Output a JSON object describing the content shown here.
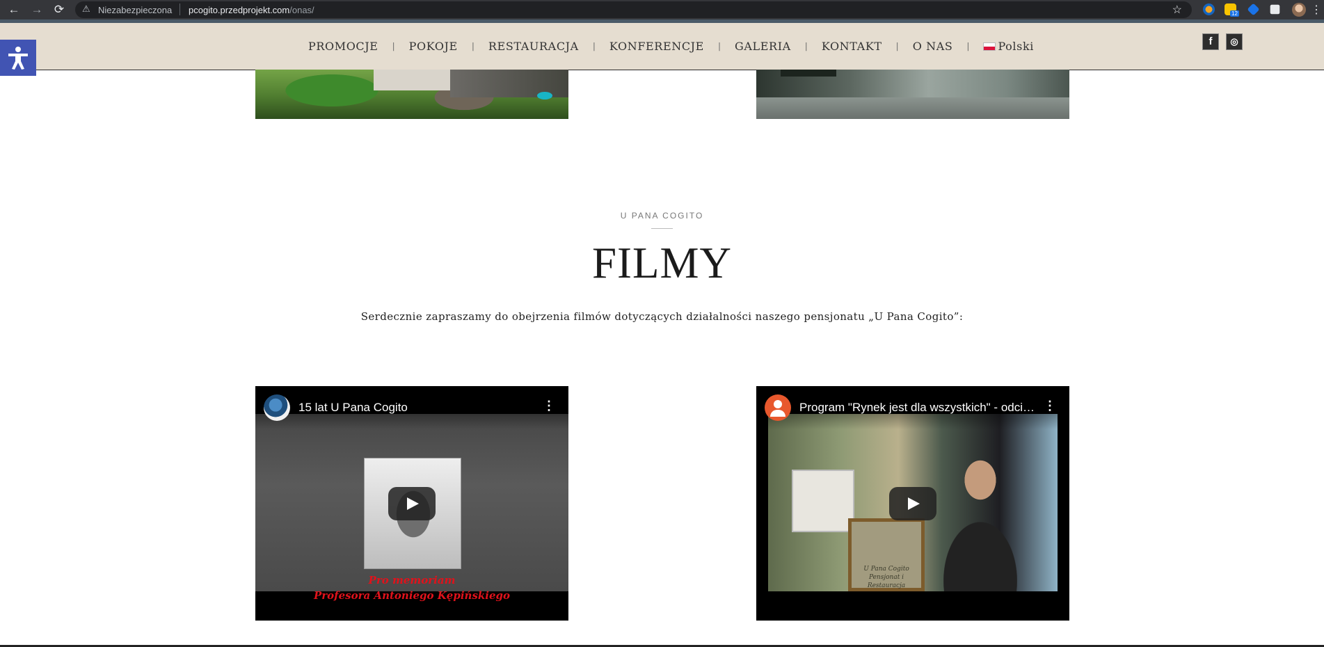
{
  "browser": {
    "security_label": "Niezabezpieczona",
    "url_domain": "pcogito.przedprojekt.com",
    "url_path": "/onas/",
    "extension_badge": "12",
    "back_icon": "←",
    "forward_icon": "→",
    "reload_icon": "⟳",
    "warning_icon": "⚠",
    "star_icon": "☆",
    "menu_icon": "⋮"
  },
  "nav": {
    "items": [
      {
        "label": "PROMOCJE"
      },
      {
        "label": "POKOJE"
      },
      {
        "label": "RESTAURACJA"
      },
      {
        "label": "KONFERENCJE"
      },
      {
        "label": "GALERIA"
      },
      {
        "label": "KONTAKT"
      },
      {
        "label": "O NAS"
      }
    ],
    "separator": "|",
    "language": "Polski",
    "facebook_glyph": "f",
    "tripadvisor_glyph": "◎"
  },
  "section": {
    "eyebrow": "U PANA COGITO",
    "title": "FILMY",
    "lead": "Serdecznie zapraszamy do obejrzenia filmów dotyczących działalności naszego pensjonatu „U Pana Cogito”:"
  },
  "videos": [
    {
      "title": "15 lat U Pana Cogito",
      "thumb_text_line1": "Pro memoriam",
      "thumb_text_line2": "Profesora Antoniego Kępińskiego"
    },
    {
      "title": "Program \"Rynek jest dla wszystkich\" - odcinek o pensjonacie U Pana Cogito",
      "frame_text_line1": "U Pana Cogito",
      "frame_text_line2": "Pensjonat i Restauracja"
    }
  ],
  "colors": {
    "nav_bg": "#e5ddd0",
    "accessibility_bg": "#4154b3",
    "thumb_red": "#e0121b"
  }
}
